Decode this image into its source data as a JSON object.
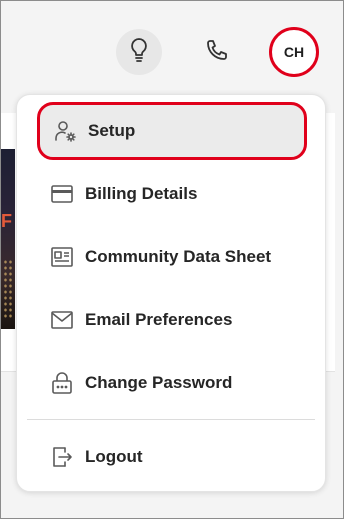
{
  "header": {
    "tips_icon": "lightbulb-icon",
    "phone_icon": "phone-icon",
    "avatar_initials": "CH"
  },
  "background": {
    "photo_text": "F"
  },
  "menu": {
    "items": [
      {
        "label": "Setup",
        "icon": "user-settings-icon",
        "highlighted": true
      },
      {
        "label": "Billing Details",
        "icon": "credit-card-icon"
      },
      {
        "label": "Community Data Sheet",
        "icon": "data-sheet-icon"
      },
      {
        "label": "Email Preferences",
        "icon": "envelope-icon"
      },
      {
        "label": "Change Password",
        "icon": "lock-icon"
      },
      {
        "label": "Logout",
        "icon": "logout-icon"
      }
    ]
  },
  "colors": {
    "highlight_ring": "#e0001b",
    "active_item_bg": "#ebebeb",
    "text": "#262626",
    "icon": "#5a5a5a"
  }
}
